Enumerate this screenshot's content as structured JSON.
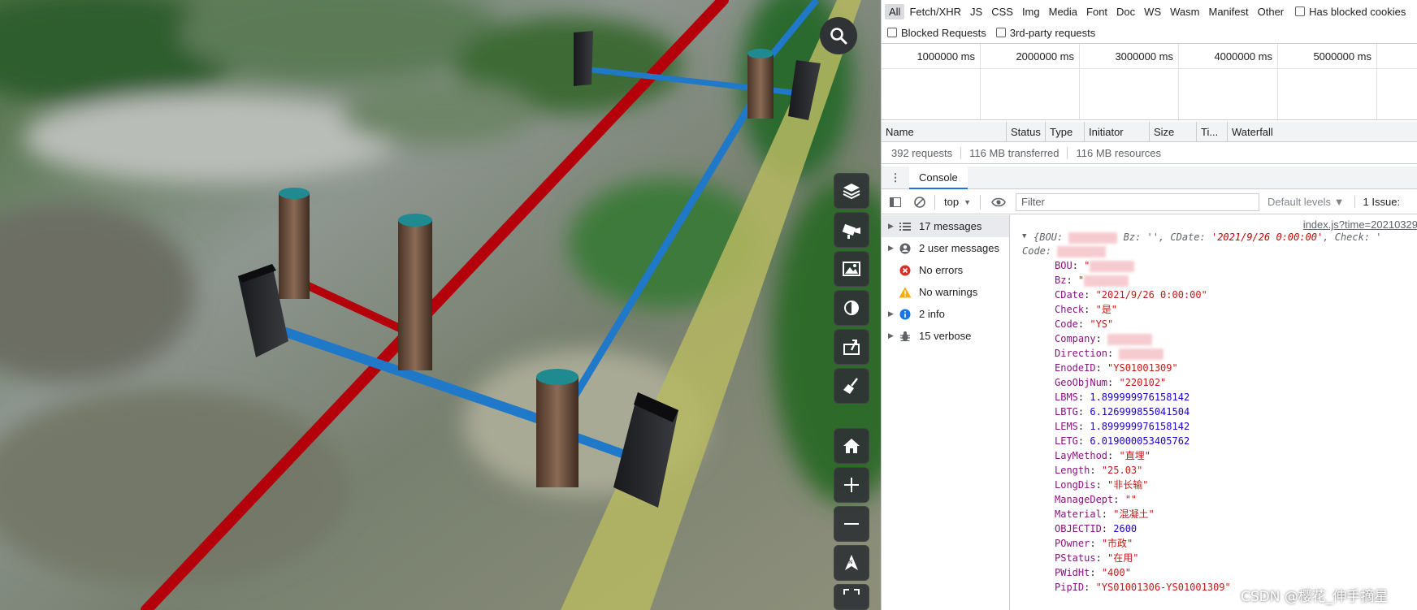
{
  "scene": {
    "toolbar": [
      {
        "name": "layers-button",
        "icon": "layers-icon"
      },
      {
        "name": "camera-button",
        "icon": "camera-icon"
      },
      {
        "name": "imagery-button",
        "icon": "image-icon"
      },
      {
        "name": "contrast-button",
        "icon": "contrast-icon"
      },
      {
        "name": "export-button",
        "icon": "export-icon"
      },
      {
        "name": "clean-button",
        "icon": "broom-icon"
      },
      {
        "name": "home-button",
        "icon": "home-icon"
      },
      {
        "name": "zoom-in-button",
        "icon": "plus-icon"
      },
      {
        "name": "zoom-out-button",
        "icon": "minus-icon"
      },
      {
        "name": "compass-button",
        "icon": "navigation-icon"
      },
      {
        "name": "fullscreen-button",
        "icon": "fullscreen-icon"
      }
    ],
    "colors": {
      "red_pipe": "#b3000b",
      "blue_pipe": "#1f78c8",
      "well": "#6e5543",
      "well_top": "#1f8a8f",
      "box": "#26272b"
    }
  },
  "devtools": {
    "filter_types": [
      "All",
      "Fetch/XHR",
      "JS",
      "CSS",
      "Img",
      "Media",
      "Font",
      "Doc",
      "WS",
      "Wasm",
      "Manifest",
      "Other"
    ],
    "has_blocked_cookies": "Has blocked cookies",
    "blocked_requests": "Blocked Requests",
    "third_party": "3rd-party requests",
    "timeline_ticks": [
      "1000000 ms",
      "2000000 ms",
      "3000000 ms",
      "4000000 ms",
      "5000000 ms"
    ],
    "columns": [
      "Name",
      "Status",
      "Type",
      "Initiator",
      "Size",
      "Ti...",
      "Waterfall"
    ],
    "summary": [
      "392 requests",
      "116 MB transferred",
      "116 MB resources"
    ],
    "drawer_tab": "Console",
    "console_toolbar": {
      "context": "top",
      "filter_placeholder": "Filter",
      "levels": "Default levels ▼",
      "issues": "1 Issue:"
    },
    "sidebar": [
      {
        "label": "17 messages",
        "icon": "list-icon",
        "arrow": true,
        "selected": true
      },
      {
        "label": "2 user messages",
        "icon": "user-icon",
        "arrow": true,
        "selected": false
      },
      {
        "label": "No errors",
        "icon": "error-icon",
        "arrow": false,
        "selected": false
      },
      {
        "label": "No warnings",
        "icon": "warning-icon",
        "arrow": false,
        "selected": false
      },
      {
        "label": "2 info",
        "icon": "info-icon",
        "arrow": true,
        "selected": false
      },
      {
        "label": "15 verbose",
        "icon": "bug-icon",
        "arrow": true,
        "selected": false
      }
    ],
    "console": {
      "source_link": "index.js?time=20210329",
      "preview_start": "{BOU:",
      "preview_bz": "Bz: '', CDate: ",
      "preview_cdate": "'2021/9/26 0:00:00'",
      "preview_check": ", Check: '",
      "code_line": "Code:",
      "properties": [
        {
          "key": "BOU",
          "value": "\"",
          "type": "str",
          "blur": true
        },
        {
          "key": "Bz",
          "value": "\"",
          "type": "str",
          "blur": true
        },
        {
          "key": "CDate",
          "value": "\"2021/9/26 0:00:00\"",
          "type": "str",
          "blur": false
        },
        {
          "key": "Check",
          "value": "\"是\"",
          "type": "str",
          "blur": false
        },
        {
          "key": "Code",
          "value": "\"YS\"",
          "type": "str",
          "blur": false
        },
        {
          "key": "Company",
          "value": "",
          "type": "str",
          "blur": true
        },
        {
          "key": "Direction",
          "value": "",
          "type": "str",
          "blur": true
        },
        {
          "key": "EnodeID",
          "value": "\"YS01001309\"",
          "type": "str",
          "blur": false
        },
        {
          "key": "GeoObjNum",
          "value": "\"220102\"",
          "type": "str",
          "blur": false
        },
        {
          "key": "LBMS",
          "value": "1.899999976158142",
          "type": "num",
          "blur": false
        },
        {
          "key": "LBTG",
          "value": "6.126999855041504",
          "type": "num",
          "blur": false
        },
        {
          "key": "LEMS",
          "value": "1.899999976158142",
          "type": "num",
          "blur": false
        },
        {
          "key": "LETG",
          "value": "6.019000053405762",
          "type": "num",
          "blur": false
        },
        {
          "key": "LayMethod",
          "value": "\"直埋\"",
          "type": "str",
          "blur": false
        },
        {
          "key": "Length",
          "value": "\"25.03\"",
          "type": "str",
          "blur": false
        },
        {
          "key": "LongDis",
          "value": "\"非长输\"",
          "type": "str",
          "blur": false
        },
        {
          "key": "ManageDept",
          "value": "\"\"",
          "type": "str",
          "blur": false
        },
        {
          "key": "Material",
          "value": "\"混凝土\"",
          "type": "str",
          "blur": false
        },
        {
          "key": "OBJECTID",
          "value": "2600",
          "type": "num",
          "blur": false
        },
        {
          "key": "POwner",
          "value": "\"市政\"",
          "type": "str",
          "blur": false
        },
        {
          "key": "PStatus",
          "value": "\"在用\"",
          "type": "str",
          "blur": false
        },
        {
          "key": "PWidHt",
          "value": "\"400\"",
          "type": "str",
          "blur": false
        },
        {
          "key": "PipID",
          "value": "\"YS01001306-YS01001309\"",
          "type": "str",
          "blur": false
        }
      ]
    }
  },
  "watermark": "CSDN @樱花_伸手摘星"
}
